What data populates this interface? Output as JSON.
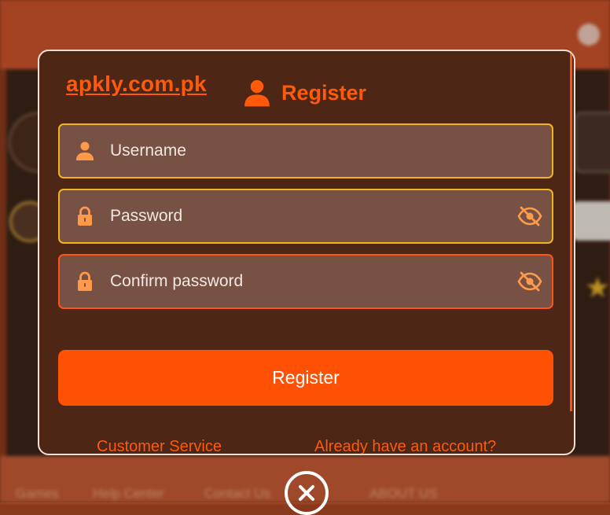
{
  "brand": {
    "text": "apkly.com.pk"
  },
  "modal": {
    "title": "Register",
    "fields": {
      "username": {
        "placeholder": "Username",
        "value": ""
      },
      "password": {
        "placeholder": "Password",
        "value": ""
      },
      "confirm": {
        "placeholder": "Confirm password",
        "value": ""
      }
    },
    "submit_label": "Register",
    "links": {
      "customer_service": "Customer Service",
      "login": "Already have an account?"
    }
  },
  "background": {
    "footer_tabs": [
      "Games",
      "Help Center",
      "Contact Us",
      "ABOUT US"
    ]
  },
  "icons": {
    "title": "user-icon",
    "username": "user-icon",
    "password": "lock-icon",
    "confirm": "lock-icon",
    "toggle": "eye-off-icon",
    "close": "close-icon"
  },
  "colors": {
    "accent": "#ff5104",
    "modal_bg": "#4e2616",
    "field_bg": "#775244",
    "field_border": "#f2b31c",
    "field_border_error": "#ff5314",
    "icon": "#ff9a4a"
  }
}
